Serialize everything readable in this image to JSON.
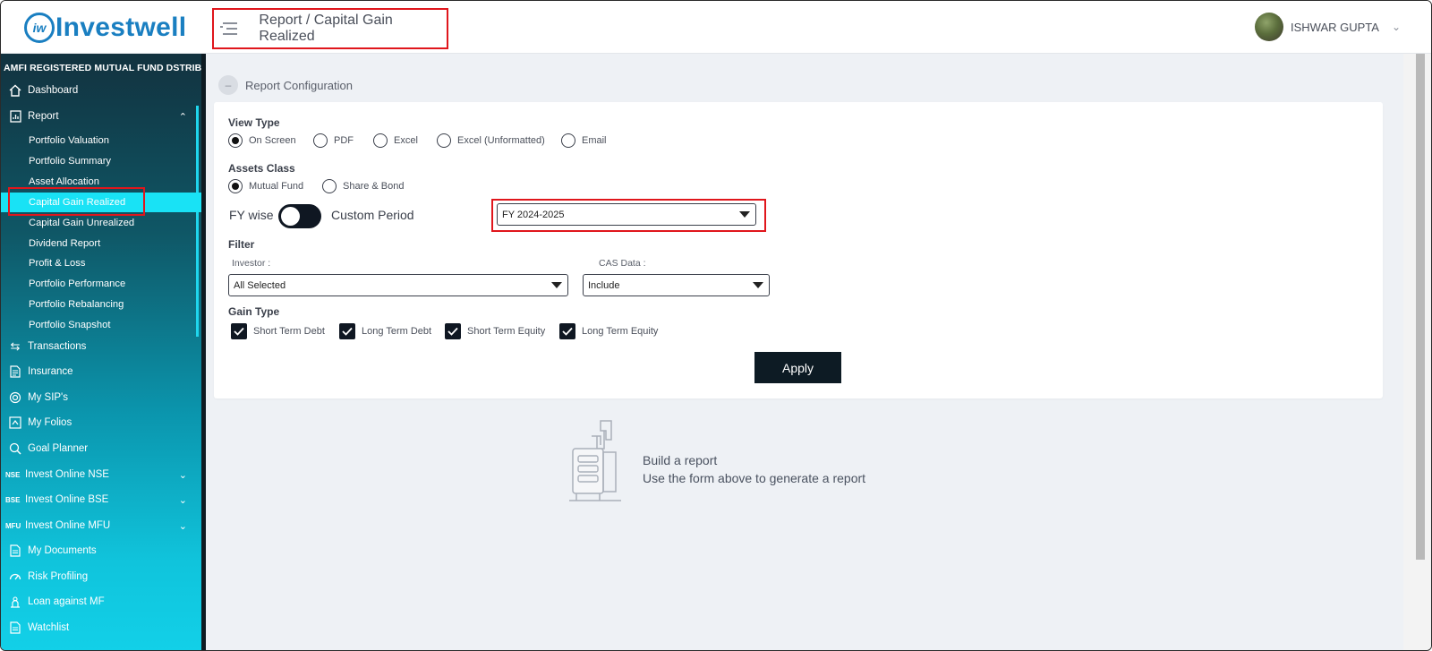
{
  "header": {
    "brand_mark": "iw",
    "brand_name": "Investwell",
    "page_title": "Report / Capital Gain Realized",
    "user_name": "ISHWAR GUPTA"
  },
  "sidebar": {
    "banner": "AMFI REGISTERED MUTUAL FUND DSTRIBUTOR",
    "items": [
      {
        "label": "Dashboard",
        "icon": "home-icon"
      },
      {
        "label": "Report",
        "icon": "report-icon"
      },
      {
        "label": "Transactions",
        "icon": "swap-icon"
      },
      {
        "label": "Insurance",
        "icon": "document-icon"
      },
      {
        "label": "My SIP's",
        "icon": "sip-icon"
      },
      {
        "label": "My Folios",
        "icon": "folio-icon"
      },
      {
        "label": "Goal Planner",
        "icon": "goal-icon"
      },
      {
        "label": "Invest Online NSE",
        "tag": "NSE"
      },
      {
        "label": "Invest Online BSE",
        "tag": "BSE"
      },
      {
        "label": "Invest Online MFU",
        "tag": "MFU"
      },
      {
        "label": "My Documents",
        "icon": "document-icon"
      },
      {
        "label": "Risk Profiling",
        "icon": "gauge-icon"
      },
      {
        "label": "Loan against MF",
        "icon": "loan-icon"
      },
      {
        "label": "Watchlist",
        "icon": "document-icon"
      }
    ],
    "report_sub": [
      "Portfolio Valuation",
      "Portfolio Summary",
      "Asset Allocation",
      "Capital Gain Realized",
      "Capital Gain Unrealized",
      "Dividend Report",
      "Profit & Loss",
      "Portfolio Performance",
      "Portfolio Rebalancing",
      "Portfolio Snapshot"
    ]
  },
  "config": {
    "title": "Report Configuration",
    "view_type": {
      "label": "View Type",
      "options": [
        "On Screen",
        "PDF",
        "Excel",
        "Excel (Unformatted)",
        "Email"
      ],
      "selected": "On Screen"
    },
    "assets_class": {
      "label": "Assets Class",
      "options": [
        "Mutual Fund",
        "Share & Bond"
      ],
      "selected": "Mutual Fund"
    },
    "period": {
      "left_label": "FY wise",
      "right_label": "Custom Period",
      "fy_value": "FY 2024-2025"
    },
    "filter": {
      "label": "Filter",
      "investor_label": "Investor :",
      "investor_value": "All Selected",
      "cas_label": "CAS Data :",
      "cas_value": "Include"
    },
    "gain_type": {
      "label": "Gain Type",
      "options": [
        "Short Term Debt",
        "Long Term Debt",
        "Short Term Equity",
        "Long Term Equity"
      ]
    },
    "apply_label": "Apply"
  },
  "empty_state": {
    "title": "Build a report",
    "subtitle": "Use the form above to generate a report"
  }
}
